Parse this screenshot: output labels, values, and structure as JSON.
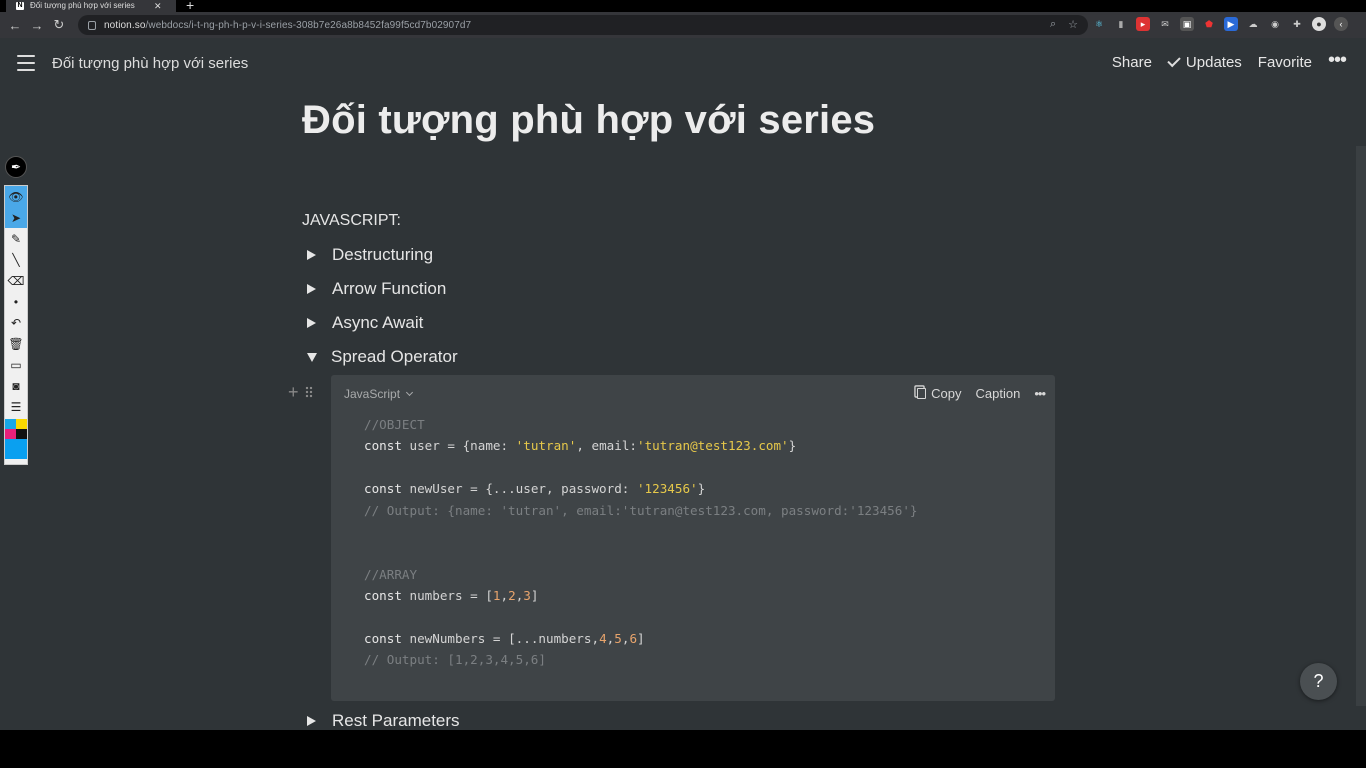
{
  "browser": {
    "tab_title": "Đối tượng phù hợp với series",
    "tab_close": "✕",
    "new_tab": "+",
    "url_host": "notion.so",
    "url_path": "/webdocs/i-t-ng-ph-h-p-v-i-series-308b7e26a8b8452fa99f5cd7b02907d7",
    "back_icon": "arrow-left-icon",
    "forward_icon": "arrow-right-icon",
    "reload_icon": "reload-icon"
  },
  "topbar": {
    "breadcrumb": "Đối tượng phù hợp với series",
    "share": "Share",
    "updates": "Updates",
    "favorite": "Favorite",
    "more": "•••"
  },
  "page": {
    "title": "Đối tượng phù hợp với series",
    "section_label": "JAVASCRIPT:",
    "toggles": [
      {
        "label": "Destructuring",
        "open": false
      },
      {
        "label": "Arrow Function",
        "open": false
      },
      {
        "label": "Async Await",
        "open": false
      },
      {
        "label": "Spread Operator",
        "open": true
      },
      {
        "label": "Rest Parameters",
        "open": false
      }
    ]
  },
  "code_block": {
    "language": "JavaScript",
    "copy": "Copy",
    "caption": "Caption",
    "more": "•••",
    "lines": [
      "//OBJECT",
      "const user = {name: 'tutran', email:'tutran@test123.com'}",
      "",
      "const newUser = {...user, password: '123456'}",
      "// Output: {name: 'tutran', email:'tutran@test123.com, password:'123456'}",
      "",
      "",
      "//ARRAY",
      "const numbers = [1,2,3]",
      "",
      "const newNumbers = [...numbers,4,5,6]",
      "// Output: [1,2,3,4,5,6]"
    ]
  },
  "help_button": "?",
  "colors": {
    "page_bg": "#2f3437",
    "code_bg": "#3f4447",
    "string": "#e6c84a",
    "number": "#e8a46c",
    "comment": "#7b7f82"
  }
}
